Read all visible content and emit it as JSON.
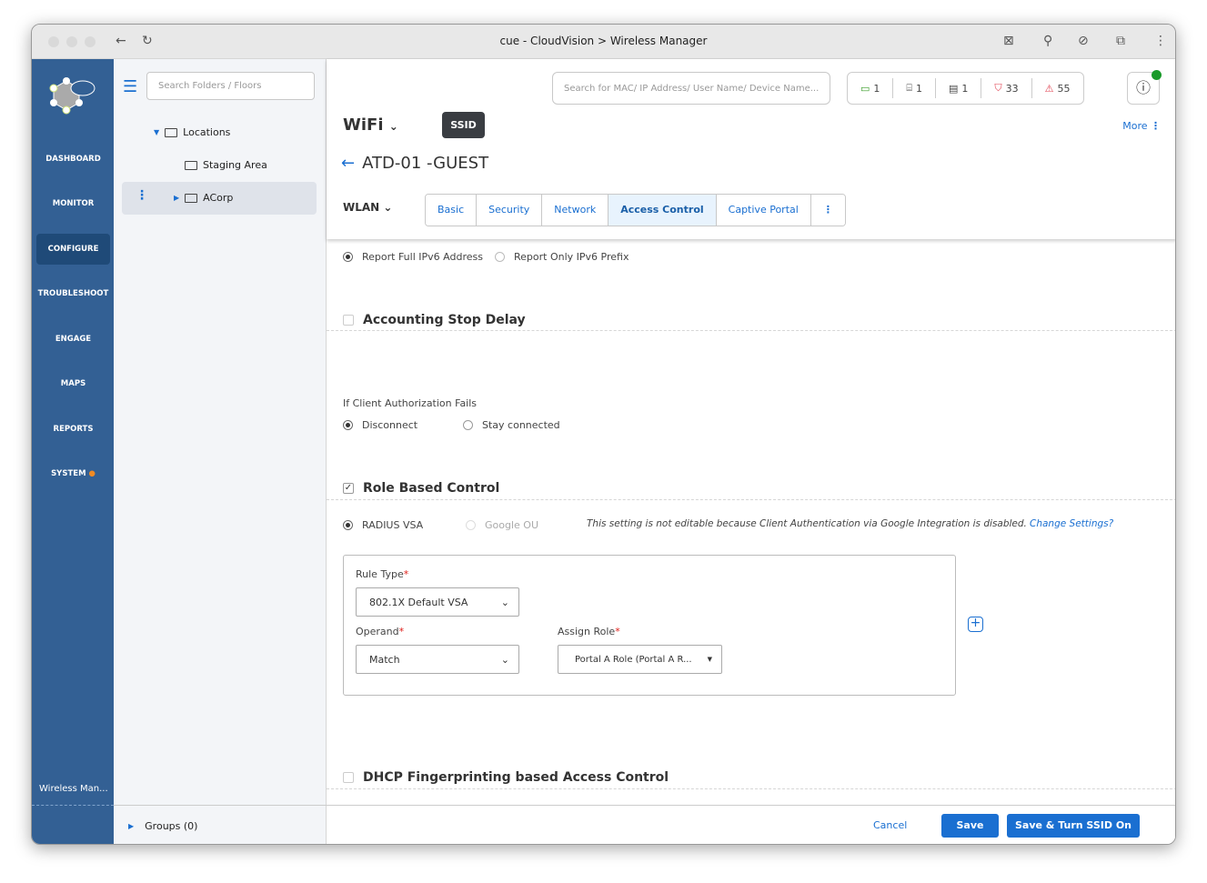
{
  "browser": {
    "title": "cue - CloudVision > Wireless Manager"
  },
  "nav": {
    "items": [
      "DASHBOARD",
      "MONITOR",
      "CONFIGURE",
      "TROUBLESHOOT",
      "ENGAGE",
      "MAPS",
      "REPORTS",
      "SYSTEM"
    ],
    "active": "CONFIGURE",
    "footer": "Wireless Man..."
  },
  "tree": {
    "search_placeholder": "Search Folders / Floors",
    "locations": "Locations",
    "staging": "Staging Area",
    "acorp": "ACorp",
    "groups": "Groups (0)"
  },
  "header": {
    "search_placeholder": "Search for MAC/ IP Address/ User Name/ Device Name...",
    "stats": [
      "1",
      "1",
      "1",
      "33",
      "55"
    ],
    "wifi": "WiFi",
    "ssid_badge": "SSID",
    "more": "More",
    "ssid_name": "ATD-01 -GUEST",
    "wlan": "WLAN",
    "tabs": [
      "Basic",
      "Security",
      "Network",
      "Access Control",
      "Captive Portal"
    ],
    "active_tab": "Access Control"
  },
  "content": {
    "report_full": "Report Full IPv6 Address",
    "report_prefix": "Report Only IPv6 Prefix",
    "acct_stop": "Accounting Stop Delay",
    "auth_fails": "If Client Authorization Fails",
    "disconnect": "Disconnect",
    "stay": "Stay connected",
    "role_based": "Role Based Control",
    "radius_vsa": "RADIUS VSA",
    "google_ou": "Google OU",
    "note": "This setting is not editable because Client Authentication via Google Integration is disabled.",
    "change_settings": "Change Settings?",
    "rule_type_label": "Rule Type",
    "rule_type": "802.1X Default VSA",
    "operand_label": "Operand",
    "operand": "Match",
    "assign_role_label": "Assign Role",
    "assign_role": "Portal A Role (Portal A R...",
    "dhcp": "DHCP Fingerprinting based Access Control"
  },
  "footer": {
    "cancel": "Cancel",
    "save": "Save",
    "save_on": "Save & Turn SSID On"
  },
  "colors": {
    "nav": "#336094",
    "accent": "#1a6fd1"
  }
}
